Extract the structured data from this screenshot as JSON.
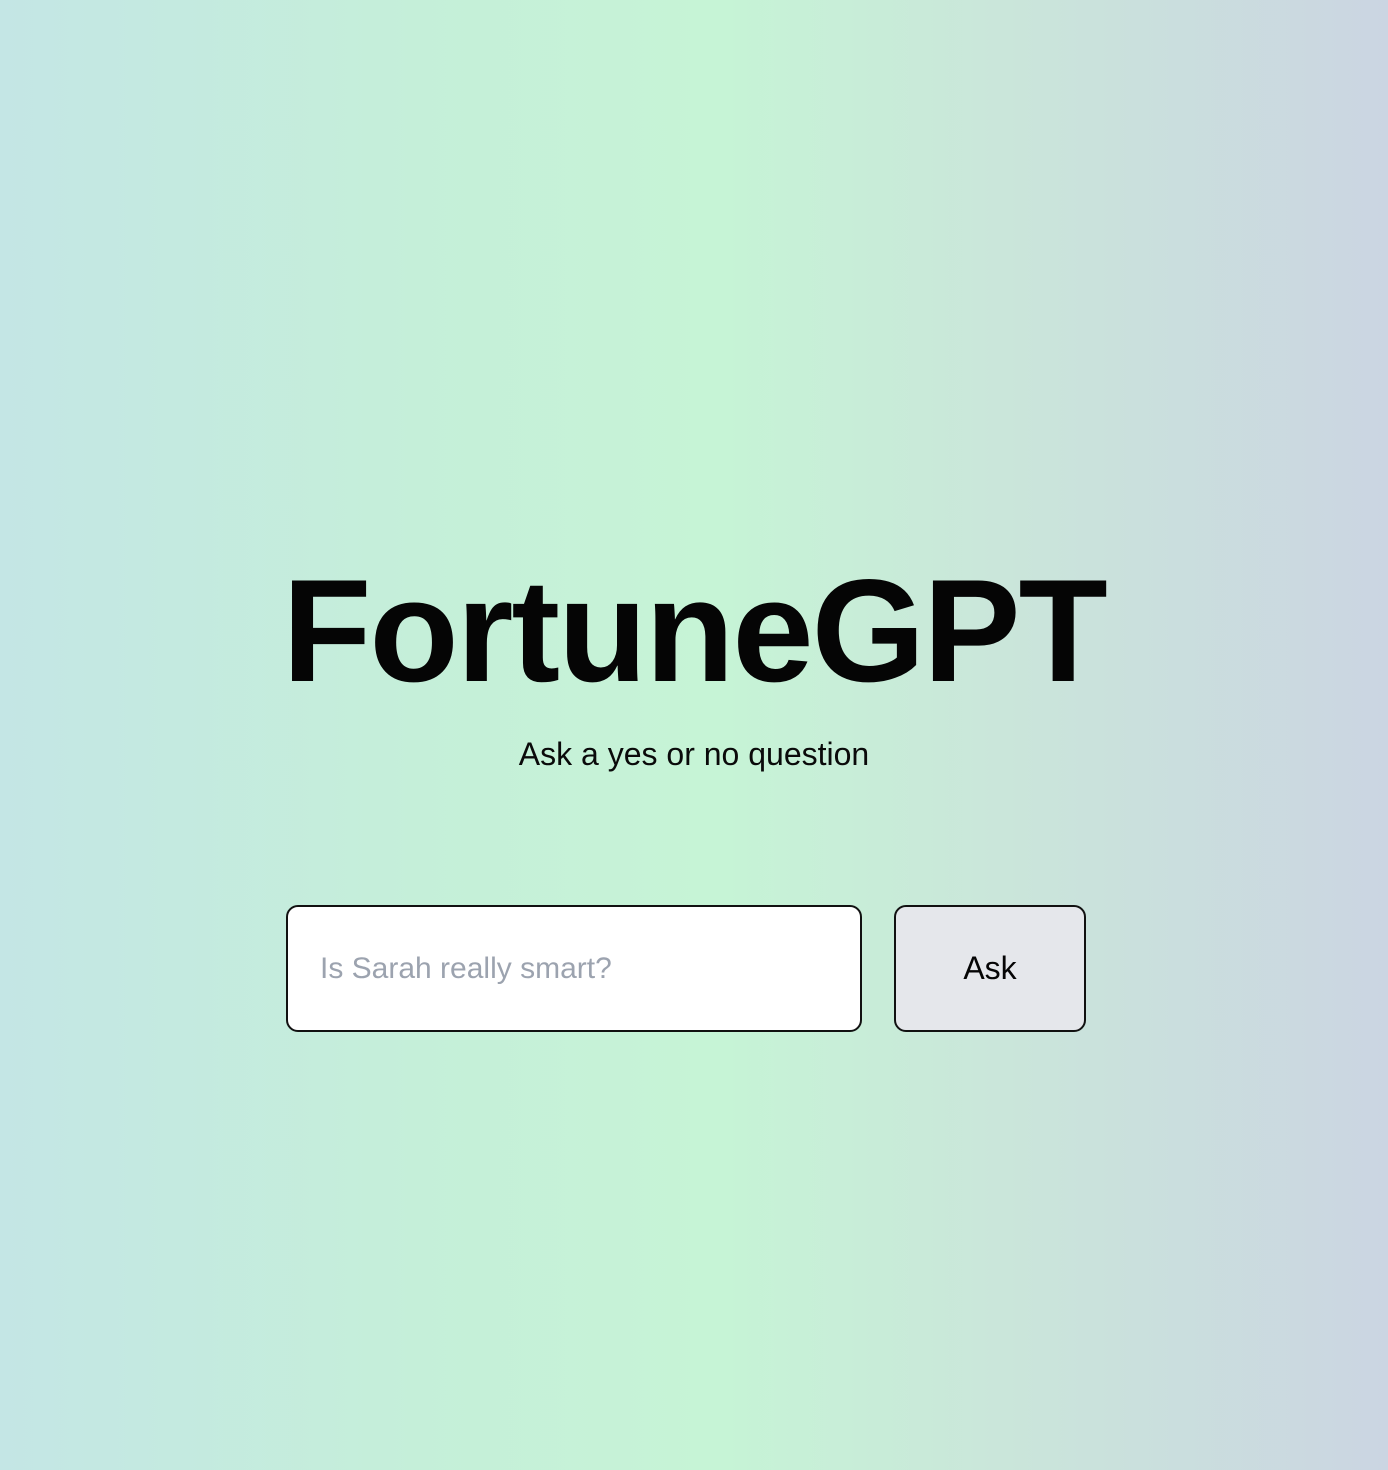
{
  "app": {
    "title": "FortuneGPT",
    "subtitle": "Ask a yes or no question"
  },
  "question_form": {
    "input_value": "",
    "input_placeholder": "Is Sarah really smart?",
    "ask_label": "Ask"
  },
  "colors": {
    "background_gradient": [
      "#c4e6e5",
      "#c6f4d6",
      "#cbd5e2"
    ],
    "input_background": "#ffffff",
    "button_background": "#e5e7eb",
    "border": "#111111",
    "placeholder": "#9ca3af",
    "text": "#050505"
  }
}
